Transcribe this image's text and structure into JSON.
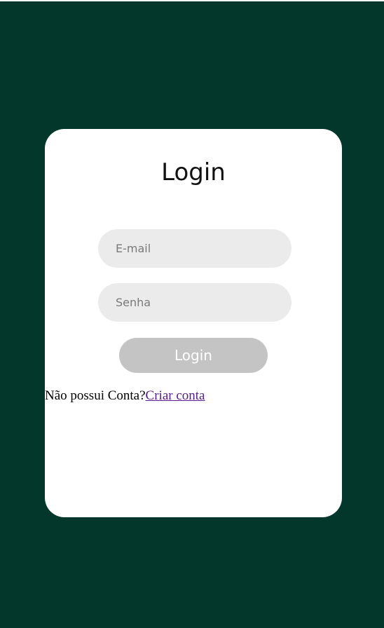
{
  "colors": {
    "background": "#03372b",
    "card": "#ffffff",
    "input_bg": "#ebebeb",
    "button_bg": "#c4c4c4",
    "link": "#551a8b"
  },
  "login": {
    "title": "Login",
    "email_placeholder": "E-mail",
    "password_placeholder": "Senha",
    "button_label": "Login",
    "no_account_text": "Não possui Conta?",
    "signup_link": "Criar conta"
  }
}
